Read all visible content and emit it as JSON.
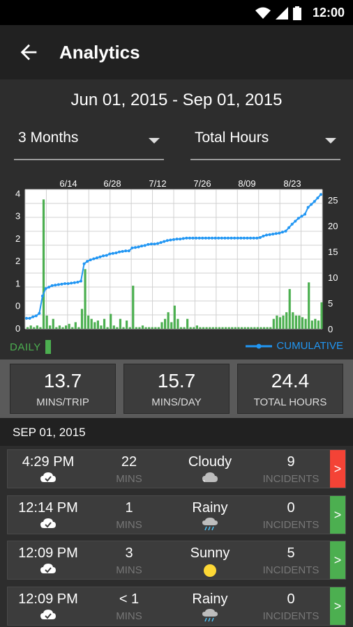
{
  "status_bar": {
    "time": "12:00"
  },
  "app_bar": {
    "title": "Analytics",
    "back_icon": "arrow-left-icon"
  },
  "date_range": "Jun 01, 2015 - Sep 01, 2015",
  "filters": {
    "period": "3 Months",
    "metric": "Total Hours"
  },
  "chart_data": {
    "type": "bar+line",
    "top_axis_labels": [
      "6/14",
      "6/28",
      "7/12",
      "7/26",
      "8/09",
      "8/23"
    ],
    "left_axis_ticks": [
      "0",
      "0",
      "1",
      "2",
      "2",
      "3",
      "4"
    ],
    "right_axis_ticks": [
      "0",
      "5",
      "10",
      "15",
      "20",
      "25"
    ],
    "daily_legend": "DAILY",
    "cumulative_legend": "CUMULATIVE",
    "daily_color": "#4caf50",
    "cumulative_color": "#2196f3",
    "daily_values": [
      0.05,
      0.1,
      0.05,
      0.1,
      0.05,
      3.9,
      0.4,
      0.1,
      0.3,
      0.05,
      0.1,
      0.05,
      0.1,
      0.15,
      0.05,
      0.2,
      0.05,
      0.6,
      1.8,
      0.4,
      0.3,
      0.2,
      0.25,
      0.1,
      0.3,
      0.05,
      0.45,
      0.1,
      0.05,
      0.3,
      0.05,
      0.25,
      0.05,
      1.3,
      0.05,
      0.05,
      0.1,
      0.05,
      0.05,
      0.05,
      0.05,
      0.05,
      0.2,
      0.3,
      0.5,
      0.2,
      0.7,
      0.3,
      0.05,
      0.05,
      0.3,
      0.05,
      0.05,
      0.1,
      0.05,
      0.05,
      0.05,
      0.05,
      0.05,
      0.05,
      0.05,
      0.05,
      0.05,
      0.05,
      0.05,
      0.05,
      0.05,
      0.05,
      0.05,
      0.05,
      0.05,
      0.05,
      0.05,
      0.05,
      0.05,
      0.05,
      0.05,
      0.3,
      0.4,
      0.35,
      0.4,
      0.5,
      1.2,
      0.5,
      0.4,
      0.4,
      0.35,
      0.3,
      1.4,
      0.25,
      0.3,
      0.25,
      0.8
    ],
    "cumulative_values": [
      1,
      1,
      1.3,
      1.5,
      2,
      5.5,
      7,
      7.3,
      7.6,
      7.7,
      7.8,
      7.9,
      8,
      8,
      8.1,
      8.2,
      8.3,
      8.5,
      12,
      12.5,
      12.8,
      13,
      13.2,
      13.4,
      13.6,
      13.7,
      14,
      14.1,
      14.2,
      14.4,
      14.5,
      14.6,
      14.6,
      15.2,
      15.3,
      15.4,
      15.6,
      15.7,
      15.9,
      16,
      16,
      16.1,
      16.3,
      16.5,
      16.7,
      16.8,
      16.9,
      17,
      17,
      17.1,
      17.2,
      17.2,
      17.2,
      17.2,
      17.2,
      17.2,
      17.2,
      17.2,
      17.2,
      17.2,
      17.2,
      17.2,
      17.2,
      17.2,
      17.2,
      17.2,
      17.2,
      17.2,
      17.2,
      17.2,
      17.2,
      17.2,
      17.2,
      17.3,
      17.6,
      17.8,
      17.9,
      18,
      18.1,
      18.2,
      18.4,
      18.6,
      19.3,
      20,
      20.6,
      21.2,
      21.6,
      22,
      23.4,
      24,
      24.6,
      25.3,
      26
    ]
  },
  "stats": [
    {
      "value": "13.7",
      "label": "MINS/TRIP"
    },
    {
      "value": "15.7",
      "label": "MINS/DAY"
    },
    {
      "value": "24.4",
      "label": "TOTAL HOURS"
    }
  ],
  "section_date": "SEP 01, 2015",
  "trips": [
    {
      "time": "4:29 PM",
      "mins": "22",
      "mins_label": "MINS",
      "weather": "Cloudy",
      "weather_icon": "cloud-icon",
      "incidents": "9",
      "incidents_label": "INCIDENTS",
      "status_color": "#f44336",
      "go": ">"
    },
    {
      "time": "12:14 PM",
      "mins": "1",
      "mins_label": "MINS",
      "weather": "Rainy",
      "weather_icon": "rain-icon",
      "incidents": "0",
      "incidents_label": "INCIDENTS",
      "status_color": "#4caf50",
      "go": ">"
    },
    {
      "time": "12:09 PM",
      "mins": "3",
      "mins_label": "MINS",
      "weather": "Sunny",
      "weather_icon": "sun-icon",
      "incidents": "5",
      "incidents_label": "INCIDENTS",
      "status_color": "#4caf50",
      "go": ">"
    },
    {
      "time": "12:09 PM",
      "mins": "< 1",
      "mins_label": "MINS",
      "weather": "Rainy",
      "weather_icon": "rain-icon",
      "incidents": "0",
      "incidents_label": "INCIDENTS",
      "status_color": "#4caf50",
      "go": ">"
    }
  ]
}
